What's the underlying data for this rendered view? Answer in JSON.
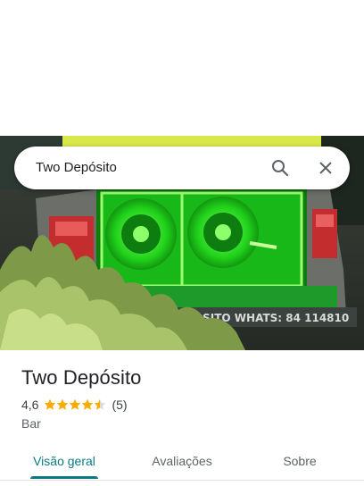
{
  "search": {
    "query": "Two Depósito",
    "search_icon": "search-icon",
    "close_icon": "close-icon"
  },
  "photo": {
    "truck_text": "DEP SITO WHATS: 84 114810"
  },
  "place": {
    "name": "Two Depósito",
    "rating": "4,6",
    "stars": 4.5,
    "review_count": "(5)",
    "category": "Bar"
  },
  "tabs": [
    {
      "label": "Visão geral",
      "active": true
    },
    {
      "label": "Avaliações",
      "active": false
    },
    {
      "label": "Sobre",
      "active": false
    }
  ],
  "colors": {
    "accent": "#0b7a80",
    "star": "#f9ab00",
    "speaker_green": "#39ff14"
  }
}
